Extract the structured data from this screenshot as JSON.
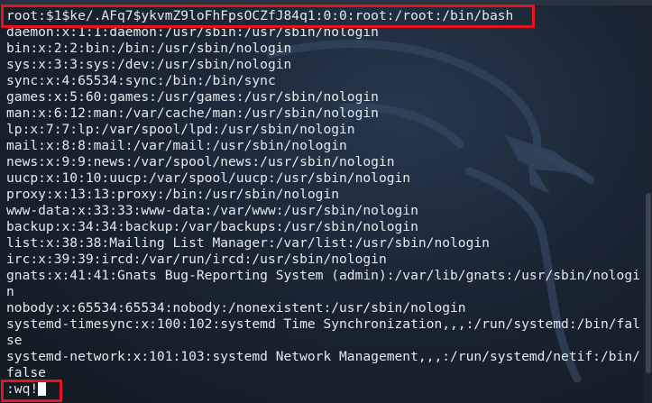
{
  "terminal": {
    "lines": [
      "root:$1$ke/.AFq7$ykvmZ9loFhFpsOCZfJ84q1:0:0:root:/root:/bin/bash",
      "daemon:x:1:1:daemon:/usr/sbin:/usr/sbin/nologin",
      "bin:x:2:2:bin:/bin:/usr/sbin/nologin",
      "sys:x:3:3:sys:/dev:/usr/sbin/nologin",
      "sync:x:4:65534:sync:/bin:/bin/sync",
      "games:x:5:60:games:/usr/games:/usr/sbin/nologin",
      "man:x:6:12:man:/var/cache/man:/usr/sbin/nologin",
      "lp:x:7:7:lp:/var/spool/lpd:/usr/sbin/nologin",
      "mail:x:8:8:mail:/var/mail:/usr/sbin/nologin",
      "news:x:9:9:news:/var/spool/news:/usr/sbin/nologin",
      "uucp:x:10:10:uucp:/var/spool/uucp:/usr/sbin/nologin",
      "proxy:x:13:13:proxy:/bin:/usr/sbin/nologin",
      "www-data:x:33:33:www-data:/var/www:/usr/sbin/nologin",
      "backup:x:34:34:backup:/var/backups:/usr/sbin/nologin",
      "list:x:38:38:Mailing List Manager:/var/list:/usr/sbin/nologin",
      "irc:x:39:39:ircd:/var/run/ircd:/usr/sbin/nologin",
      "gnats:x:41:41:Gnats Bug-Reporting System (admin):/var/lib/gnats:/usr/sbin/nologi",
      "n",
      "nobody:x:65534:65534:nobody:/nonexistent:/usr/sbin/nologin",
      "systemd-timesync:x:100:102:systemd Time Synchronization,,,:/run/systemd:/bin/fal",
      "se",
      "systemd-network:x:101:103:systemd Network Management,,,:/run/systemd/netif:/bin/",
      "false"
    ],
    "command_line": ":wq!"
  },
  "colors": {
    "highlight": "#e8141c",
    "text": "#e6e9ec",
    "background": "#1a2533"
  }
}
